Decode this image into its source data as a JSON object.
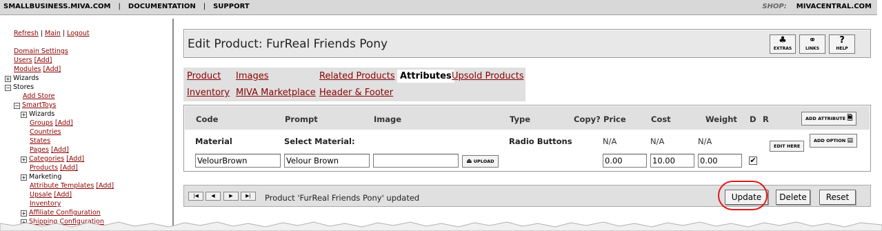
{
  "topbar": {
    "links": [
      "SMALLBUSINESS.MIVA.COM",
      "DOCUMENTATION",
      "SUPPORT"
    ],
    "separator": "|",
    "shop_label": "SHOP:",
    "shop_value": "MIVACENTRAL.COM"
  },
  "sidebar": {
    "refresh": "Refresh",
    "main": "Main",
    "logout": "Logout",
    "sep": "|",
    "domain_settings": "Domain Settings",
    "users": "Users",
    "modules": "Modules",
    "add": "[Add]",
    "wizards": "Wizards",
    "stores": "Stores",
    "add_store": "Add Store",
    "smarttoys": "SmartToys",
    "store_wizards": "Wizards",
    "groups": "Groups",
    "countries": "Countries",
    "states": "States",
    "pages": "Pages",
    "categories": "Categories",
    "products": "Products",
    "marketing": "Marketing",
    "attribute_templates": "Attribute Templates",
    "upsale": "Upsale",
    "inventory": "Inventory",
    "affiliate_configuration": "Affiliate Configuration",
    "shipping_configuration": "Shipping Configuration",
    "plus": "+",
    "minus": "−"
  },
  "header": {
    "title": "Edit Product: FurReal Friends Pony",
    "buttons": [
      {
        "label": "EXTRAS",
        "icon": "puzzle-icon"
      },
      {
        "label": "LINKS",
        "icon": "chain-link-icon"
      },
      {
        "label": "HELP",
        "icon": "question-icon"
      }
    ]
  },
  "tabs": {
    "product": "Product",
    "images": "Images",
    "related": "Related Products",
    "attributes": "Attributes",
    "upsold": "Upsold Products",
    "inventory": "Inventory",
    "marketplace": "MIVA Marketplace",
    "header_footer": "Header & Footer"
  },
  "attributes": {
    "columns": [
      "Code",
      "Prompt",
      "Image",
      "Type",
      "Copy?",
      "Price",
      "Cost",
      "Weight",
      "D",
      "R"
    ],
    "add_attribute": "ADD ATTRIBUTE",
    "row": {
      "code": "Material",
      "prompt": "Select Material:",
      "type": "Radio Buttons",
      "price": "N/A",
      "cost": "N/A",
      "weight": "N/A",
      "edit_here": "EDIT HERE",
      "add_option": "ADD OPTION"
    },
    "option": {
      "code": "VelourBrown",
      "prompt": "Velour Brown",
      "image": "",
      "upload": "UPLOAD",
      "price": "0.00",
      "cost": "10.00",
      "weight": "0.00",
      "default_check": "✔"
    }
  },
  "footer": {
    "nav": [
      "|◀",
      "◀",
      "▶",
      "▶|"
    ],
    "status": "Product 'FurReal Friends Pony' updated",
    "update": "Update",
    "delete": "Delete",
    "reset": "Reset"
  },
  "colors": {
    "link": "#8b0000",
    "panel": "#e0e0e0",
    "highlight": "#e01818"
  }
}
